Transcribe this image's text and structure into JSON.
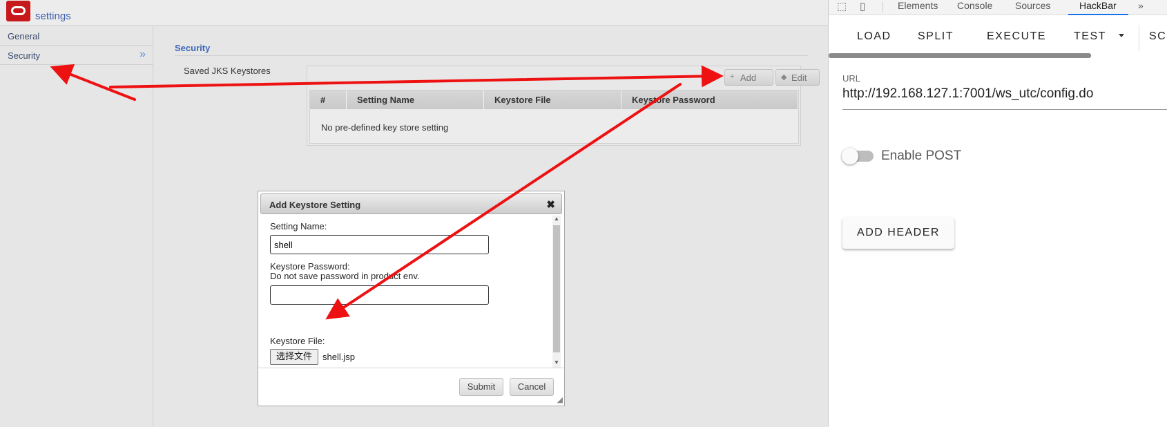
{
  "app": {
    "title": "settings"
  },
  "sidebar": {
    "items": [
      {
        "label": "General"
      },
      {
        "label": "Security"
      }
    ],
    "chevron": "»"
  },
  "main": {
    "section_heading": "Security",
    "saved_keystores_label": "Saved JKS Keystores",
    "add_label": "Add",
    "edit_label": "Edit",
    "table": {
      "columns": [
        "#",
        "Setting Name",
        "Keystore File",
        "Keystore Password"
      ],
      "empty_message": "No pre-defined key store setting"
    }
  },
  "dialog": {
    "title": "Add Keystore Setting",
    "close_icon": "✖",
    "setting_name_label": "Setting Name:",
    "setting_name_value": "shell",
    "keystore_password_label": "Keystore Password:",
    "keystore_password_hint": "Do not save password in product env.",
    "keystore_password_value": "",
    "keystore_file_label": "Keystore File:",
    "choose_file_label": "选择文件",
    "file_name": "shell.jsp",
    "submit_label": "Submit",
    "cancel_label": "Cancel"
  },
  "devtools": {
    "tabs": [
      "Elements",
      "Console",
      "Sources",
      "HackBar"
    ],
    "active_tab": "HackBar",
    "more_icon": "»"
  },
  "hackbar": {
    "buttons": {
      "load": "LOAD",
      "split": "SPLIT",
      "execute": "EXECUTE",
      "test": "TEST",
      "sc": "SC"
    },
    "url_label": "URL",
    "url_value": "http://192.168.127.1:7001/ws_utc/config.do",
    "enable_post_label": "Enable POST",
    "enable_post": false,
    "add_header_label": "ADD HEADER",
    "accent_color": "#1a73e8"
  },
  "annotation": {
    "arrow_color": "#ee1111"
  }
}
